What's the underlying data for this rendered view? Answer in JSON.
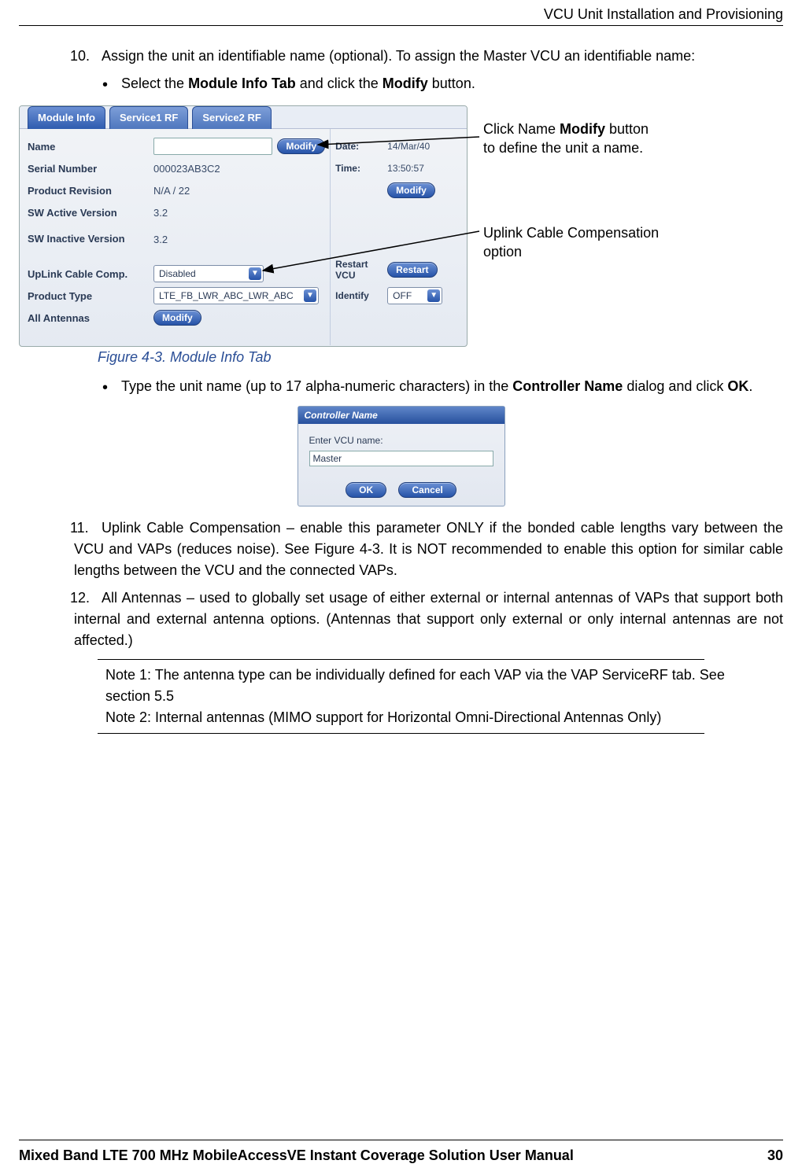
{
  "header": {
    "running_title": "VCU Unit Installation and Provisioning"
  },
  "step10": {
    "number": "10.",
    "text_a": "Assign the unit an identifiable name (optional). To assign the Master VCU an identifiable name:",
    "bullet1_a": "Select the ",
    "bullet1_bold1": "Module Info Tab",
    "bullet1_mid": " and click the ",
    "bullet1_bold2": "Modify",
    "bullet1_end": " button."
  },
  "module_panel": {
    "tabs": [
      "Module Info",
      "Service1 RF",
      "Service2 RF"
    ],
    "rows": {
      "name_label": "Name",
      "serial_label": "Serial Number",
      "serial_value": "000023AB3C2",
      "prodrev_label": "Product Revision",
      "prodrev_value": "N/A / 22",
      "swact_label": "SW Active Version",
      "swact_value": "3.2",
      "swinact_label": "SW Inactive Version",
      "swinact_value": "3.2",
      "uplink_label": "UpLink Cable Comp.",
      "uplink_value": "Disabled",
      "prodtype_label": "Product Type",
      "prodtype_value": "LTE_FB_LWR_ABC_LWR_ABC",
      "allant_label": "All Antennas"
    },
    "right": {
      "date_label": "Date:",
      "date_value": "14/Mar/40",
      "time_label": "Time:",
      "time_value": "13:50:57",
      "restart_label": "Restart VCU",
      "identify_label": "Identify",
      "identify_value": "OFF"
    },
    "buttons": {
      "modify": "Modify",
      "restart": "Restart"
    }
  },
  "callouts": {
    "c1_a": "Click Name ",
    "c1_bold": "Modify",
    "c1_b": " button to define the unit a name.",
    "c2": "Uplink Cable Compensation option"
  },
  "figure_caption": "Figure 4-3. Module Info Tab",
  "step10b": {
    "a": "Type the unit name (up to 17 alpha-numeric characters) in the ",
    "bold1": "Controller Name",
    "mid": " dialog and click ",
    "bold2": "OK",
    "end": "."
  },
  "dialog": {
    "title": "Controller Name",
    "prompt": "Enter VCU name:",
    "value": "Master",
    "ok": "OK",
    "cancel": "Cancel"
  },
  "step11": {
    "number": "11.",
    "text": "Uplink Cable Compensation – enable this parameter ONLY if the bonded cable lengths vary between the VCU and VAPs (reduces noise). See Figure 4-3. It is NOT recommended to enable this option for similar cable lengths between the VCU and the connected VAPs."
  },
  "step12": {
    "number": "12.",
    "text": "All Antennas – used to globally set usage of either external or internal antennas of VAPs that support both internal and external antenna options. (Antennas that support only external or only internal antennas are not affected.)"
  },
  "notes": {
    "n1": "Note 1: The antenna type can be individually defined for each VAP via the VAP ServiceRF tab. See section 5.5",
    "n2": "Note 2: Internal antennas (MIMO support for Horizontal Omni-Directional Antennas Only)"
  },
  "footer": {
    "title": "Mixed Band LTE 700 MHz MobileAccessVE Instant Coverage Solution User Manual",
    "page": "30"
  }
}
